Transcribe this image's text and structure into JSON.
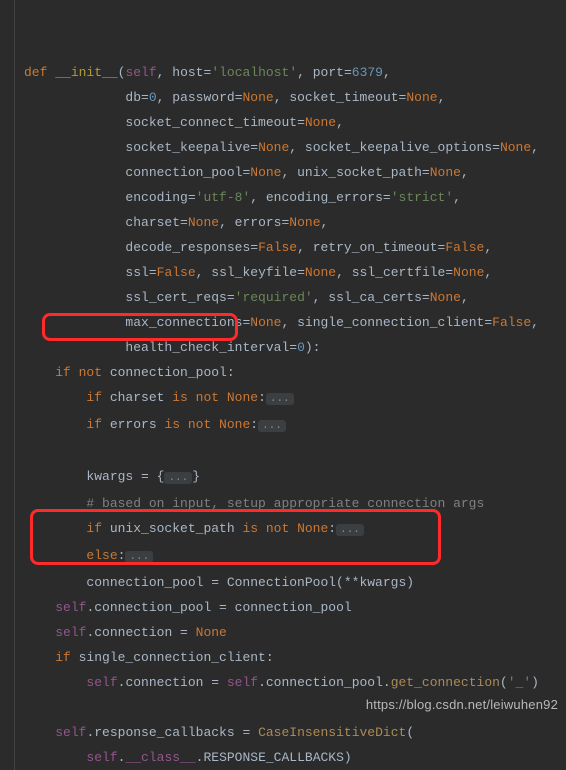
{
  "chart_data": {
    "type": "table",
    "title": "Python source snippet (presumed redis-py Redis.__init__)",
    "note": "Two regions are highlighted with red rounded rectangles.",
    "highlights": [
      "if not connection_pool:",
      "connection_pool = ConnectionPool(**kwargs)\\nself.connection_pool = connection_pool"
    ]
  },
  "code": {
    "l01a": "def ",
    "l01b": "__init__",
    "l01c": "(",
    "l01d": "self",
    "l01e": ", ",
    "l01f": "host",
    "l01g": "=",
    "l01h": "'localhost'",
    "l01i": ", ",
    "l01j": "port",
    "l01k": "=",
    "l01l": "6379",
    "l01m": ",",
    "l02a": "             ",
    "l02b": "db",
    "l02c": "=",
    "l02d": "0",
    "l02e": ", ",
    "l02f": "password",
    "l02g": "=",
    "l02h": "None",
    "l02i": ", ",
    "l02j": "socket_timeout",
    "l02k": "=",
    "l02l": "None",
    "l02m": ",",
    "l03a": "             ",
    "l03b": "socket_connect_timeout",
    "l03c": "=",
    "l03d": "None",
    "l03e": ",",
    "l04a": "             ",
    "l04b": "socket_keepalive",
    "l04c": "=",
    "l04d": "None",
    "l04e": ", ",
    "l04f": "socket_keepalive_options",
    "l04g": "=",
    "l04h": "None",
    "l04i": ",",
    "l05a": "             ",
    "l05b": "connection_pool",
    "l05c": "=",
    "l05d": "None",
    "l05e": ", ",
    "l05f": "unix_socket_path",
    "l05g": "=",
    "l05h": "None",
    "l05i": ",",
    "l06a": "             ",
    "l06b": "encoding",
    "l06c": "=",
    "l06d": "'utf-8'",
    "l06e": ", ",
    "l06f": "encoding_errors",
    "l06g": "=",
    "l06h": "'strict'",
    "l06i": ",",
    "l07a": "             ",
    "l07b": "charset",
    "l07c": "=",
    "l07d": "None",
    "l07e": ", ",
    "l07f": "errors",
    "l07g": "=",
    "l07h": "None",
    "l07i": ",",
    "l08a": "             ",
    "l08b": "decode_responses",
    "l08c": "=",
    "l08d": "False",
    "l08e": ", ",
    "l08f": "retry_on_timeout",
    "l08g": "=",
    "l08h": "False",
    "l08i": ",",
    "l09a": "             ",
    "l09b": "ssl",
    "l09c": "=",
    "l09d": "False",
    "l09e": ", ",
    "l09f": "ssl_keyfile",
    "l09g": "=",
    "l09h": "None",
    "l09i": ", ",
    "l09j": "ssl_certfile",
    "l09k": "=",
    "l09l": "None",
    "l09m": ",",
    "l10a": "             ",
    "l10b": "ssl_cert_reqs",
    "l10c": "=",
    "l10d": "'required'",
    "l10e": ", ",
    "l10f": "ssl_ca_certs",
    "l10g": "=",
    "l10h": "None",
    "l10i": ",",
    "l11a": "             ",
    "l11b": "max_connections",
    "l11c": "=",
    "l11d": "None",
    "l11e": ", ",
    "l11f": "single_connection_client",
    "l11g": "=",
    "l11h": "False",
    "l11i": ",",
    "l12a": "             ",
    "l12b": "health_check_interval",
    "l12c": "=",
    "l12d": "0",
    "l12e": "):",
    "l13a": "    ",
    "l13b": "if not ",
    "l13c": "connection_pool:",
    "l14a": "        ",
    "l14b": "if ",
    "l14c": "charset ",
    "l14d": "is not ",
    "l14e": "None",
    "l14f": ":",
    "l14g": "...",
    "l15a": "        ",
    "l15b": "if ",
    "l15c": "errors ",
    "l15d": "is not ",
    "l15e": "None",
    "l15f": ":",
    "l15g": "...",
    "l16a": "",
    "l17a": "        kwargs = {",
    "l17b": "...",
    "l17c": "}",
    "l18a": "        ",
    "l18b": "# based on input, setup appropriate connection args",
    "l19a": "        ",
    "l19b": "if ",
    "l19c": "unix_socket_path ",
    "l19d": "is not ",
    "l19e": "None",
    "l19f": ":",
    "l19g": "...",
    "l20a": "        ",
    "l20b": "else",
    "l20c": ":",
    "l20d": "...",
    "l21a": "        connection_pool = ConnectionPool(**kwargs)",
    "l22a": "    ",
    "l22b": "self",
    "l22c": ".connection_pool = connection_pool",
    "l23a": "    ",
    "l23b": "self",
    "l23c": ".connection = ",
    "l23d": "None",
    "l24a": "    ",
    "l24b": "if ",
    "l24c": "single_connection_client:",
    "l25a": "        ",
    "l25b": "self",
    "l25c": ".connection = ",
    "l25d": "self",
    "l25e": ".connection_pool.",
    "l25f": "get_connection",
    "l25g": "(",
    "l25h": "'_'",
    "l25i": ")",
    "l26a": "",
    "l27a": "    ",
    "l27b": "self",
    "l27c": ".response_callbacks = ",
    "l27d": "CaseInsensitiveDict",
    "l27e": "(",
    "l28a": "        ",
    "l28b": "self",
    "l28c": ".",
    "l28d": "__class__",
    "l28e": ".RESPONSE_CALLBACKS)"
  },
  "watermark": "https://blog.csdn.net/leiwuhen92"
}
